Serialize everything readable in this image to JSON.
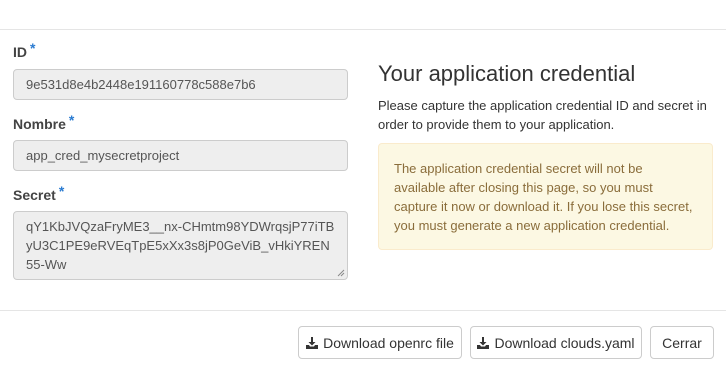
{
  "form": {
    "id": {
      "label": "ID",
      "required_mark": "*",
      "value": "9e531d8e4b2448e191160778c588e7b6"
    },
    "name": {
      "label": "Nombre",
      "required_mark": "*",
      "value": "app_cred_mysecretproject"
    },
    "secret": {
      "label": "Secret",
      "required_mark": "*",
      "value": "qY1KbJVQzaFryME3__nx-CHmtm98YDWrqsjP77iTByU3C1PE9eRVEqTpE5xXx3s8jP0GeViB_vHkiYREN55-Ww"
    }
  },
  "panel": {
    "title": "Your application credential",
    "description": "Please capture the application credential ID and secret in order to provide them to your application.",
    "warning": "The application credential secret will not be available after closing this page, so you must capture it now or download it. If you lose this secret, you must generate a new application credential."
  },
  "footer": {
    "download_openrc_label": "Download openrc file",
    "download_clouds_label": "Download clouds.yaml",
    "close_label": "Cerrar"
  },
  "icons": {
    "download": "download-icon"
  },
  "colors": {
    "required_asterisk": "#2a7bd1",
    "warning_background": "#fcf8e3",
    "warning_text": "#8a6d3b",
    "readonly_field_background": "#eeeeee"
  }
}
